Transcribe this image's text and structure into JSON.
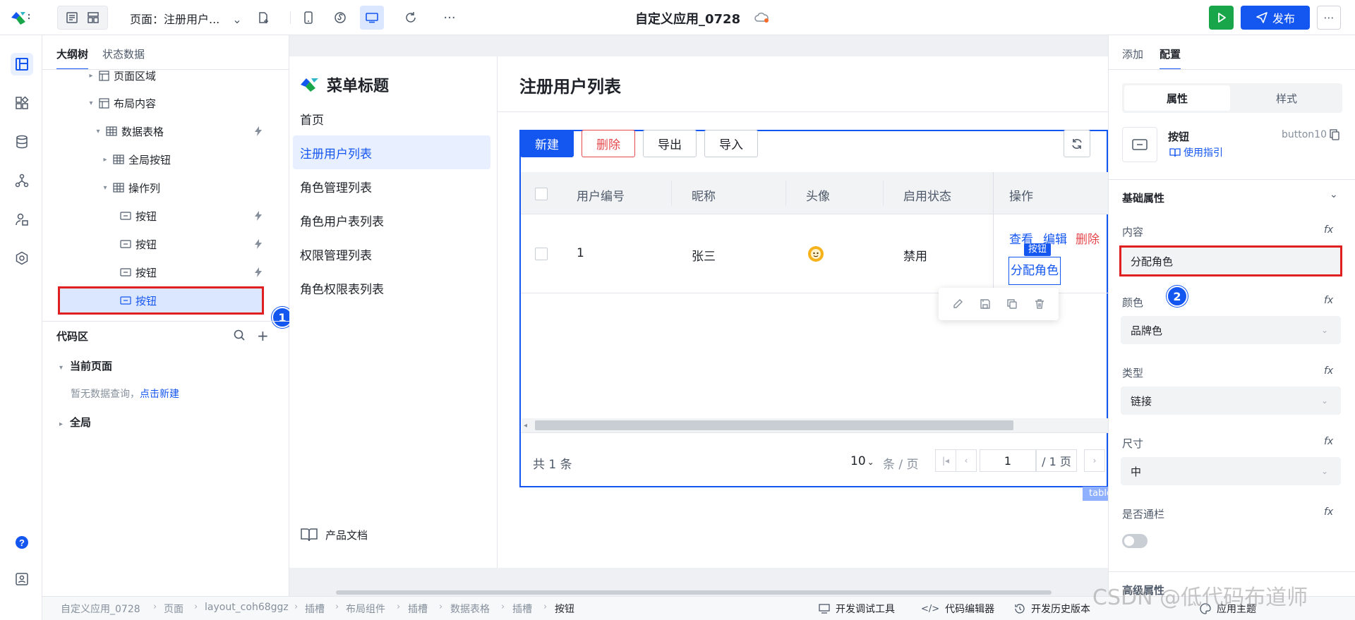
{
  "topbar": {
    "page_select": "页面：注册用户...",
    "app_title": "自定义应用_0728",
    "publish_label": "发布",
    "more_label": "⋯",
    "toolbar_more": "···"
  },
  "outline": {
    "tabs": [
      "大纲树",
      "状态数据"
    ],
    "tree": [
      {
        "label": "页面区域",
        "partial": true
      },
      {
        "label": "布局内容"
      },
      {
        "label": "数据表格"
      },
      {
        "label": "全局按钮"
      },
      {
        "label": "操作列"
      },
      {
        "label": "按钮"
      },
      {
        "label": "按钮"
      },
      {
        "label": "按钮"
      },
      {
        "label": "按钮"
      }
    ],
    "code_area": {
      "title": "代码区",
      "current_page": "当前页面",
      "empty_text": "暂无数据查询，",
      "create_link": "点击新建",
      "global": "全局"
    },
    "badge1": "1"
  },
  "menu": {
    "title": "菜单标题",
    "items": [
      "首页",
      "注册用户列表",
      "角色管理列表",
      "角色用户表列表",
      "权限管理列表",
      "角色权限表列表"
    ],
    "active_index": 1,
    "docs": "产品文档"
  },
  "content": {
    "title": "注册用户列表",
    "buttons": {
      "new": "新建",
      "delete": "删除",
      "export": "导出",
      "import": "导入"
    },
    "columns": [
      "用户编号",
      "昵称",
      "头像",
      "启用状态",
      "操作"
    ],
    "rows": [
      {
        "id": "1",
        "nickname": "张三",
        "status": "禁用",
        "actions": [
          "查看",
          "编辑",
          "删除"
        ],
        "assign": "分配角色"
      }
    ],
    "selected_tag": "按钮",
    "pagination": {
      "total_prefix": "共",
      "total": "1",
      "total_suffix": "条",
      "page_size": "10",
      "per_page": "条 / 页",
      "current": "1",
      "pages": "/ 1 页"
    },
    "table_tag": "table"
  },
  "rpanel": {
    "tabs": [
      "添加",
      "配置"
    ],
    "seg": [
      "属性",
      "样式"
    ],
    "component_name": "按钮",
    "component_id": "button10",
    "guide": "使用指引",
    "section": "基础属性",
    "fields": {
      "content_label": "内容",
      "content_value": "分配角色",
      "color_label": "颜色",
      "color_value": "品牌色",
      "type_label": "类型",
      "type_value": "链接",
      "size_label": "尺寸",
      "size_value": "中",
      "block_label": "是否通栏"
    },
    "fx": "fx",
    "advanced": "高级属性",
    "badge2": "2"
  },
  "breadcrumb": {
    "items": [
      "自定义应用_0728",
      "页面",
      "layout_coh68ggz",
      "插槽",
      "布局组件",
      "插槽",
      "数据表格",
      "插槽",
      "按钮"
    ],
    "tools": [
      "开发调试工具",
      "代码编辑器",
      "开发历史版本",
      "应用主题"
    ]
  },
  "watermark": "CSDN @低代码布道师",
  "colors": {
    "brand": "#1456f0",
    "run": "#19a64a",
    "danger": "#e02020"
  }
}
